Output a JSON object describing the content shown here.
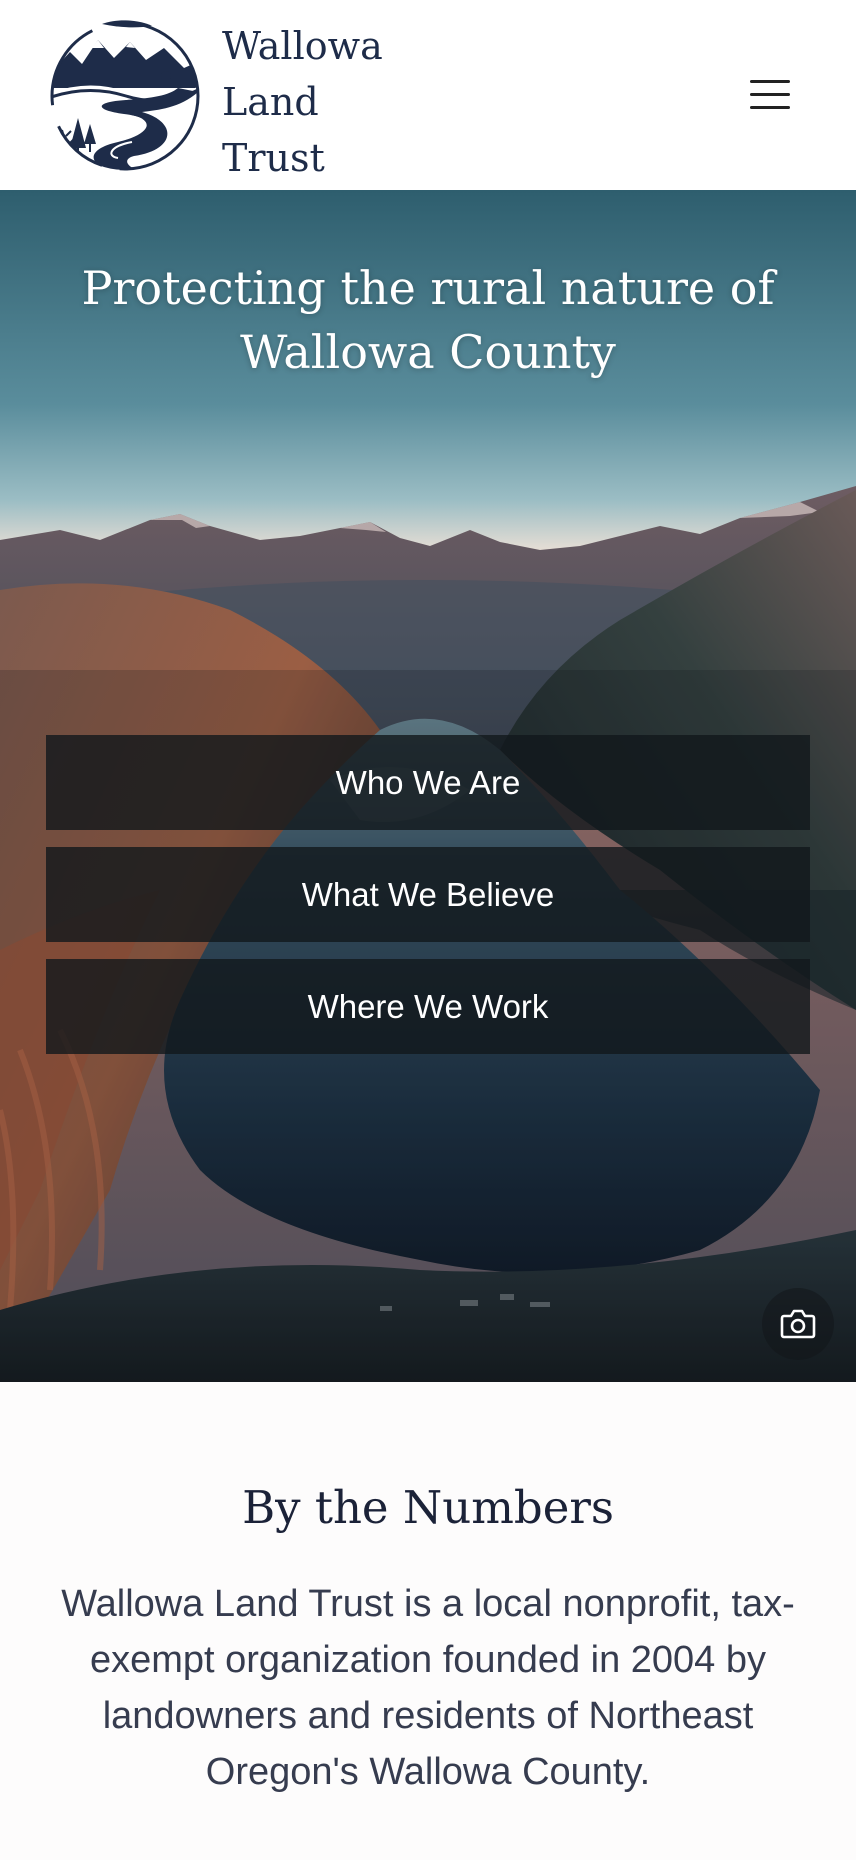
{
  "header": {
    "logo_alt": "Wallowa Land Trust",
    "logo_lines": [
      "Wallowa",
      "Land",
      "Trust"
    ],
    "menu_label": "Menu"
  },
  "hero": {
    "title": "Protecting the rural nature of Wallowa County",
    "links": [
      {
        "label": "Who We Are"
      },
      {
        "label": "What We Believe"
      },
      {
        "label": "Where We Work"
      }
    ],
    "photo_credit_label": "Photo credit"
  },
  "numbers": {
    "heading": "By the Numbers",
    "body": "Wallowa Land Trust is a local nonprofit, tax-exempt organization founded in 2004 by landowners and residents of Northeast Oregon's Wallowa County."
  },
  "icons": {
    "logo": "wallowa-landscape-emblem",
    "menu": "hamburger-menu-icon",
    "photo": "camera-icon"
  },
  "colors": {
    "brand_navy": "#1e2c49",
    "header_bg": "#ffffff",
    "button_bg": "#12181c",
    "heading": "#1b2238",
    "body_text": "#363c4f"
  }
}
